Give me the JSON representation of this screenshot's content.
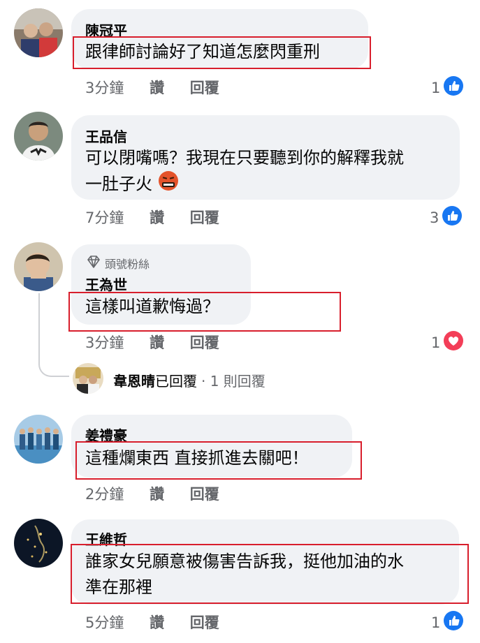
{
  "comments": [
    {
      "name": "陳冠平",
      "lines": [
        "跟律師討論好了知道怎麼閃重刑"
      ],
      "time": "3分鐘",
      "like_label": "讚",
      "reply_label": "回覆",
      "reaction": {
        "type": "like",
        "count": "1"
      }
    },
    {
      "name": "王品信",
      "lines": [
        "可以閉嘴嗎？我現在只要聽到你的解釋我就",
        "一肚子火"
      ],
      "emoji": "angry-face-emoji",
      "time": "7分鐘",
      "like_label": "讚",
      "reply_label": "回覆",
      "reaction": {
        "type": "like",
        "count": "3"
      }
    },
    {
      "badge": "頭號粉絲",
      "name": "王為世",
      "lines": [
        "這樣叫道歉悔過？"
      ],
      "time": "3分鐘",
      "like_label": "讚",
      "reply_label": "回覆",
      "reaction": {
        "type": "love",
        "count": "1"
      },
      "replies_summary": {
        "name": "韋恩晴",
        "action": "已回覆",
        "count": "· 1 則回覆"
      }
    },
    {
      "name": "姜禮豪",
      "lines": [
        "這種爛東西 直接抓進去關吧！"
      ],
      "time": "2分鐘",
      "like_label": "讚",
      "reply_label": "回覆"
    },
    {
      "name": "王維哲",
      "lines": [
        "誰家女兒願意被傷害告訴我，挺他加油的水",
        "準在那裡"
      ],
      "time": "5分鐘",
      "like_label": "讚",
      "reply_label": "回覆",
      "reaction": {
        "type": "like",
        "count": "1"
      }
    }
  ],
  "colors": {
    "bubble": "#f0f2f5",
    "meta": "#65676b",
    "like_blue": "#1877f2",
    "love_red": "#f33e58",
    "highlight": "#d81e2c"
  }
}
